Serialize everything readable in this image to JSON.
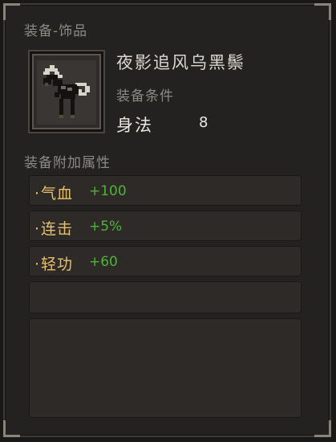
{
  "panel": {
    "category": "装备-饰品",
    "item_name": "夜影追风乌黑鬃",
    "item_icon": "black-horse-icon",
    "requirement": {
      "title": "装备条件",
      "label": "身法",
      "value": "8"
    },
    "attributes_title": "装备附加属性",
    "attributes": [
      {
        "bullet": "·",
        "name": "气血",
        "value": "+100"
      },
      {
        "bullet": "·",
        "name": "连击",
        "value": "+5%"
      },
      {
        "bullet": "·",
        "name": "轻功",
        "value": "+60"
      }
    ]
  },
  "colors": {
    "attribute_name": "#e6c070",
    "attribute_value": "#4fb33a",
    "muted_text": "#8d8a84"
  }
}
